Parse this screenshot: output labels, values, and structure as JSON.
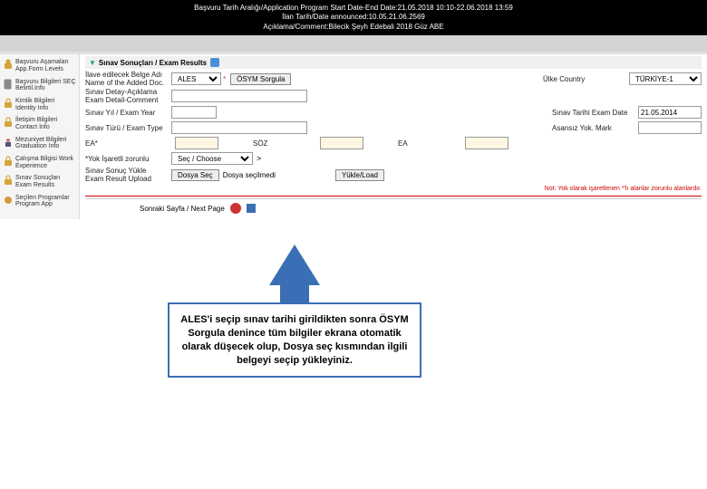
{
  "header": {
    "line1": "Başvuru Tarih Aralığı/Application Program Start Date-End Date:21.05.2018 10:10-22.06.2018 13:59",
    "line2": "İlan Tarih/Date announced:10.05.21.06.2569",
    "line3": "Açıklama/Comment:Bilecik Şeyh Edebali 2018 Güz ABE"
  },
  "sidebar": {
    "items": [
      {
        "label": "Başvuru Aşamaları\nApp.Form Levels",
        "icon": "lock-icon"
      },
      {
        "label": "Başvuru Bilgileri\nSEÇ Belirtil.Info",
        "icon": "doc-icon"
      },
      {
        "label": "Kimlik Bilgileri\nIdentity Info",
        "icon": "lock-icon"
      },
      {
        "label": "İletişim Bilgileri\nContact Info",
        "icon": "lock-icon"
      },
      {
        "label": "Mezuniyet Bilgileri\nGraduation Info",
        "icon": "grad-icon"
      },
      {
        "label": "Çalışma Bilgisi\nWork Experience",
        "icon": "lock-icon"
      },
      {
        "label": "Sınav Sonuçları\nExam Results",
        "icon": "lock-icon"
      },
      {
        "label": "Seçilen Programlar\nProgram App",
        "icon": "gear-icon"
      }
    ]
  },
  "section": {
    "title": "Sınav Sonuçları / Exam Results"
  },
  "form": {
    "doc_label": "İlave edilecek Belge Adı\nName of the Added Doc.",
    "detail_label": "Sınav Detay-Açıklama\nExam Detail-Comment",
    "year_label": "Sınav Yıl / Exam Year",
    "type_label": "Sınav Türü / Exam Type",
    "ea_label": "EA*",
    "yok_label": "*Yok İşaretli zorunlu",
    "upload_label": "Sınav Sonuç Yükle\nExam Result Upload",
    "exam_sel": "ALES",
    "osym_btn": "ÖSYM Sorgula",
    "country_label": "Ülke Country",
    "country_val": "TÜRKİYE-1",
    "examdate_label": "Sınav Tarihi Exam Date",
    "examdate_val": "21.05.2014",
    "score_label": "Asansız Yok. Mark",
    "soz_label": "SÖZ",
    "ea2_label": "EA",
    "choose_label": "Seç / Choose",
    "dosya_btn": "Dosya Seç",
    "dosya_status": "Dosya seçilmedi",
    "yukle_btn": "Yükle/Load"
  },
  "note": {
    "red": "Not: Yok olarak işaretlenen *'lı alanlar zorunlu alanlardır."
  },
  "next": {
    "label": "Sonraki Sayfa / Next Page"
  },
  "callout": {
    "text": "ALES'i seçip sınav tarihi girildikten sonra ÖSYM Sorgula denince tüm bilgiler ekrana otomatik olarak düşecek olup, Dosya seç kısmından ilgili belgeyi seçip yükleyiniz."
  }
}
